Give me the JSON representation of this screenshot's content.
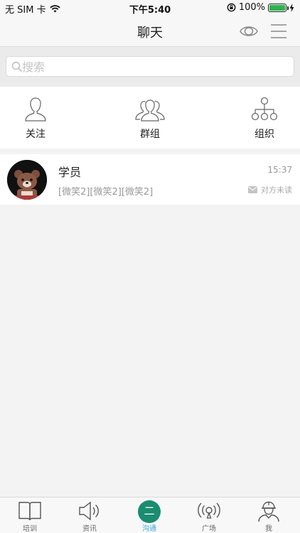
{
  "status_bar": {
    "carrier": "无 SIM 卡",
    "time": "下午5:40",
    "battery": "100%"
  },
  "nav": {
    "title": "聊天"
  },
  "search": {
    "placeholder": "搜索",
    "value": ""
  },
  "quick_actions": [
    {
      "label": "关注",
      "icon": "user-icon"
    },
    {
      "label": "群组",
      "icon": "group-icon"
    },
    {
      "label": "组织",
      "icon": "org-chart-icon"
    }
  ],
  "chats": [
    {
      "name": "学员",
      "time": "15:37",
      "preview": "[微笑2][微笑2][微笑2]",
      "status": "对方未读",
      "avatar": "bear-avatar"
    }
  ],
  "tabs": [
    {
      "label": "培训",
      "icon": "book-icon"
    },
    {
      "label": "资讯",
      "icon": "speaker-icon"
    },
    {
      "label": "沟通",
      "icon": "chat-bubble-icon",
      "active": true,
      "badge_text": "二"
    },
    {
      "label": "广场",
      "icon": "broadcast-icon"
    },
    {
      "label": "我",
      "icon": "worker-icon"
    }
  ],
  "colors": {
    "accent": "#3fa7db",
    "active_bubble": "#1a8c70",
    "battery": "#2fb24c"
  }
}
